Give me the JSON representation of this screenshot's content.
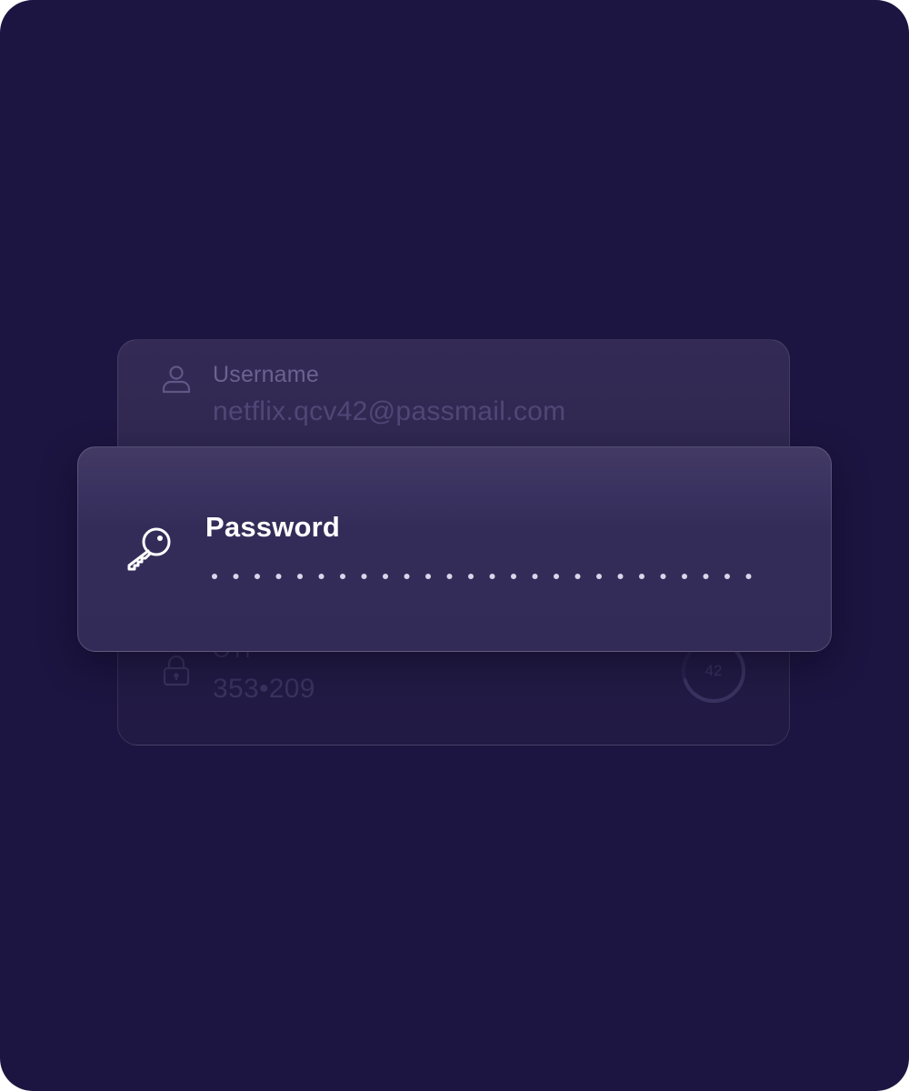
{
  "username": {
    "label": "Username",
    "value": "netflix.qcv42@passmail.com",
    "icon": "user-icon"
  },
  "password": {
    "label": "Password",
    "masked_length": 26,
    "icon": "key-icon"
  },
  "otp": {
    "label": "OTP",
    "code": "353•209",
    "seconds_remaining": "42",
    "timer_progress": 0.7,
    "icon": "lock-icon"
  },
  "colors": {
    "background": "#1c1541",
    "card": "#332b57",
    "text_primary": "#ffffff",
    "text_muted": "#6a6390"
  }
}
